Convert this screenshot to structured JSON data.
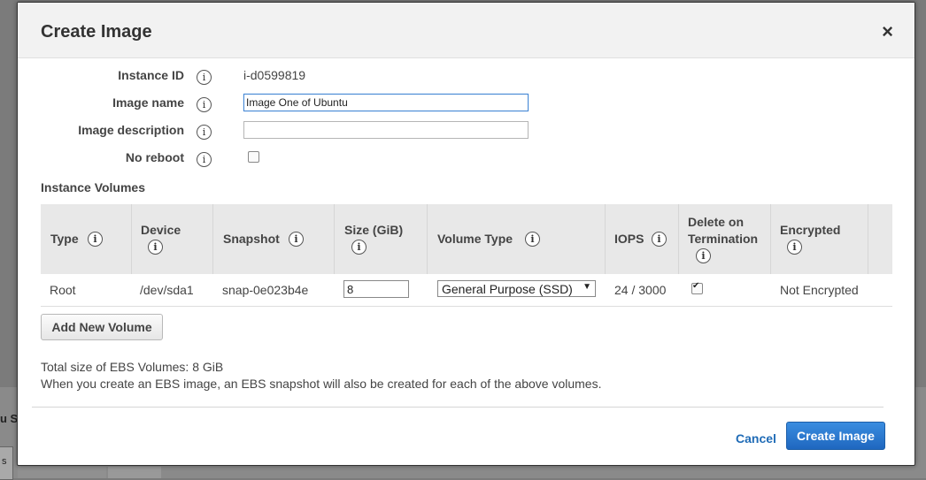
{
  "background": {
    "text": "u S",
    "tab_text": "s"
  },
  "modal": {
    "title": "Create Image",
    "close_symbol": "×",
    "info_symbol": "i",
    "fields": {
      "instance_id_label": "Instance ID",
      "instance_id_value": "i-d0599819",
      "image_name_label": "Image name",
      "image_name_value": "Image One of Ubuntu",
      "image_description_label": "Image description",
      "image_description_value": "",
      "no_reboot_label": "No reboot",
      "no_reboot_checked": false
    },
    "volumes": {
      "section_title": "Instance Volumes",
      "headers": {
        "type": "Type",
        "device": "Device",
        "snapshot": "Snapshot",
        "size": "Size (GiB)",
        "volume_type": "Volume Type",
        "iops": "IOPS",
        "delete_line1": "Delete on",
        "delete_line2": "Termination",
        "encrypted": "Encrypted"
      },
      "rows": [
        {
          "type": "Root",
          "device": "/dev/sda1",
          "snapshot": "snap-0e023b4e",
          "size": "8",
          "volume_type": "General Purpose (SSD)",
          "iops": "24 / 3000",
          "delete_on_termination": true,
          "encrypted": "Not Encrypted"
        }
      ],
      "add_button": "Add New Volume"
    },
    "summary": {
      "total_size": "Total size of EBS Volumes: 8 GiB",
      "note": "When you create an EBS image, an EBS snapshot will also be created for each of the above volumes."
    },
    "footer": {
      "cancel_label": "Cancel",
      "create_label": "Create Image"
    }
  },
  "colors": {
    "primary_button": "#2a78d2",
    "link": "#1f6bb6",
    "header_bg": "#f2f2f2",
    "table_header_bg": "#e8e8e8"
  }
}
